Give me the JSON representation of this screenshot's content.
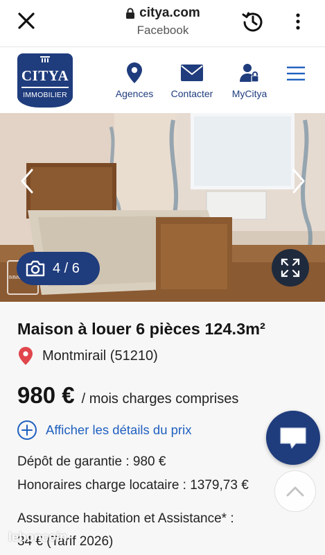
{
  "browser": {
    "domain": "citya.com",
    "referrer": "Facebook",
    "icons": [
      "close-icon",
      "lock-icon",
      "history-icon",
      "more-vertical-icon"
    ]
  },
  "header": {
    "logo_top": "CITYA",
    "logo_bottom": "IMMOBILIER",
    "nav": [
      {
        "label": "Agences",
        "icon": "location-pin-icon"
      },
      {
        "label": "Contacter",
        "icon": "envelope-icon"
      },
      {
        "label": "MyCitya",
        "icon": "user-lock-icon"
      }
    ],
    "menu_icon": "hamburger-menu-icon"
  },
  "gallery": {
    "counter": "4 / 6",
    "current": 4,
    "total": 6,
    "watermark": "IMMOBILIER"
  },
  "listing": {
    "title": "Maison à louer 6 pièces 124.3m²",
    "location": "Montmirail (51210)",
    "price": "980 €",
    "price_suffix": "/ mois charges comprises",
    "details_link": "Afficher les détails du prix",
    "deposit": "Dépôt de garantie : 980 €",
    "fees": "Honoraires charge locataire : 1379,73 €",
    "insurance_line1": "Assurance habitation et Assistance* :",
    "insurance_line2": "34 € (Tarif 2026)"
  },
  "overlay": {
    "watermark": "leboncoin"
  },
  "colors": {
    "brand": "#1f3c7d",
    "link": "#1f5fbf",
    "pin": "#e0464c"
  }
}
